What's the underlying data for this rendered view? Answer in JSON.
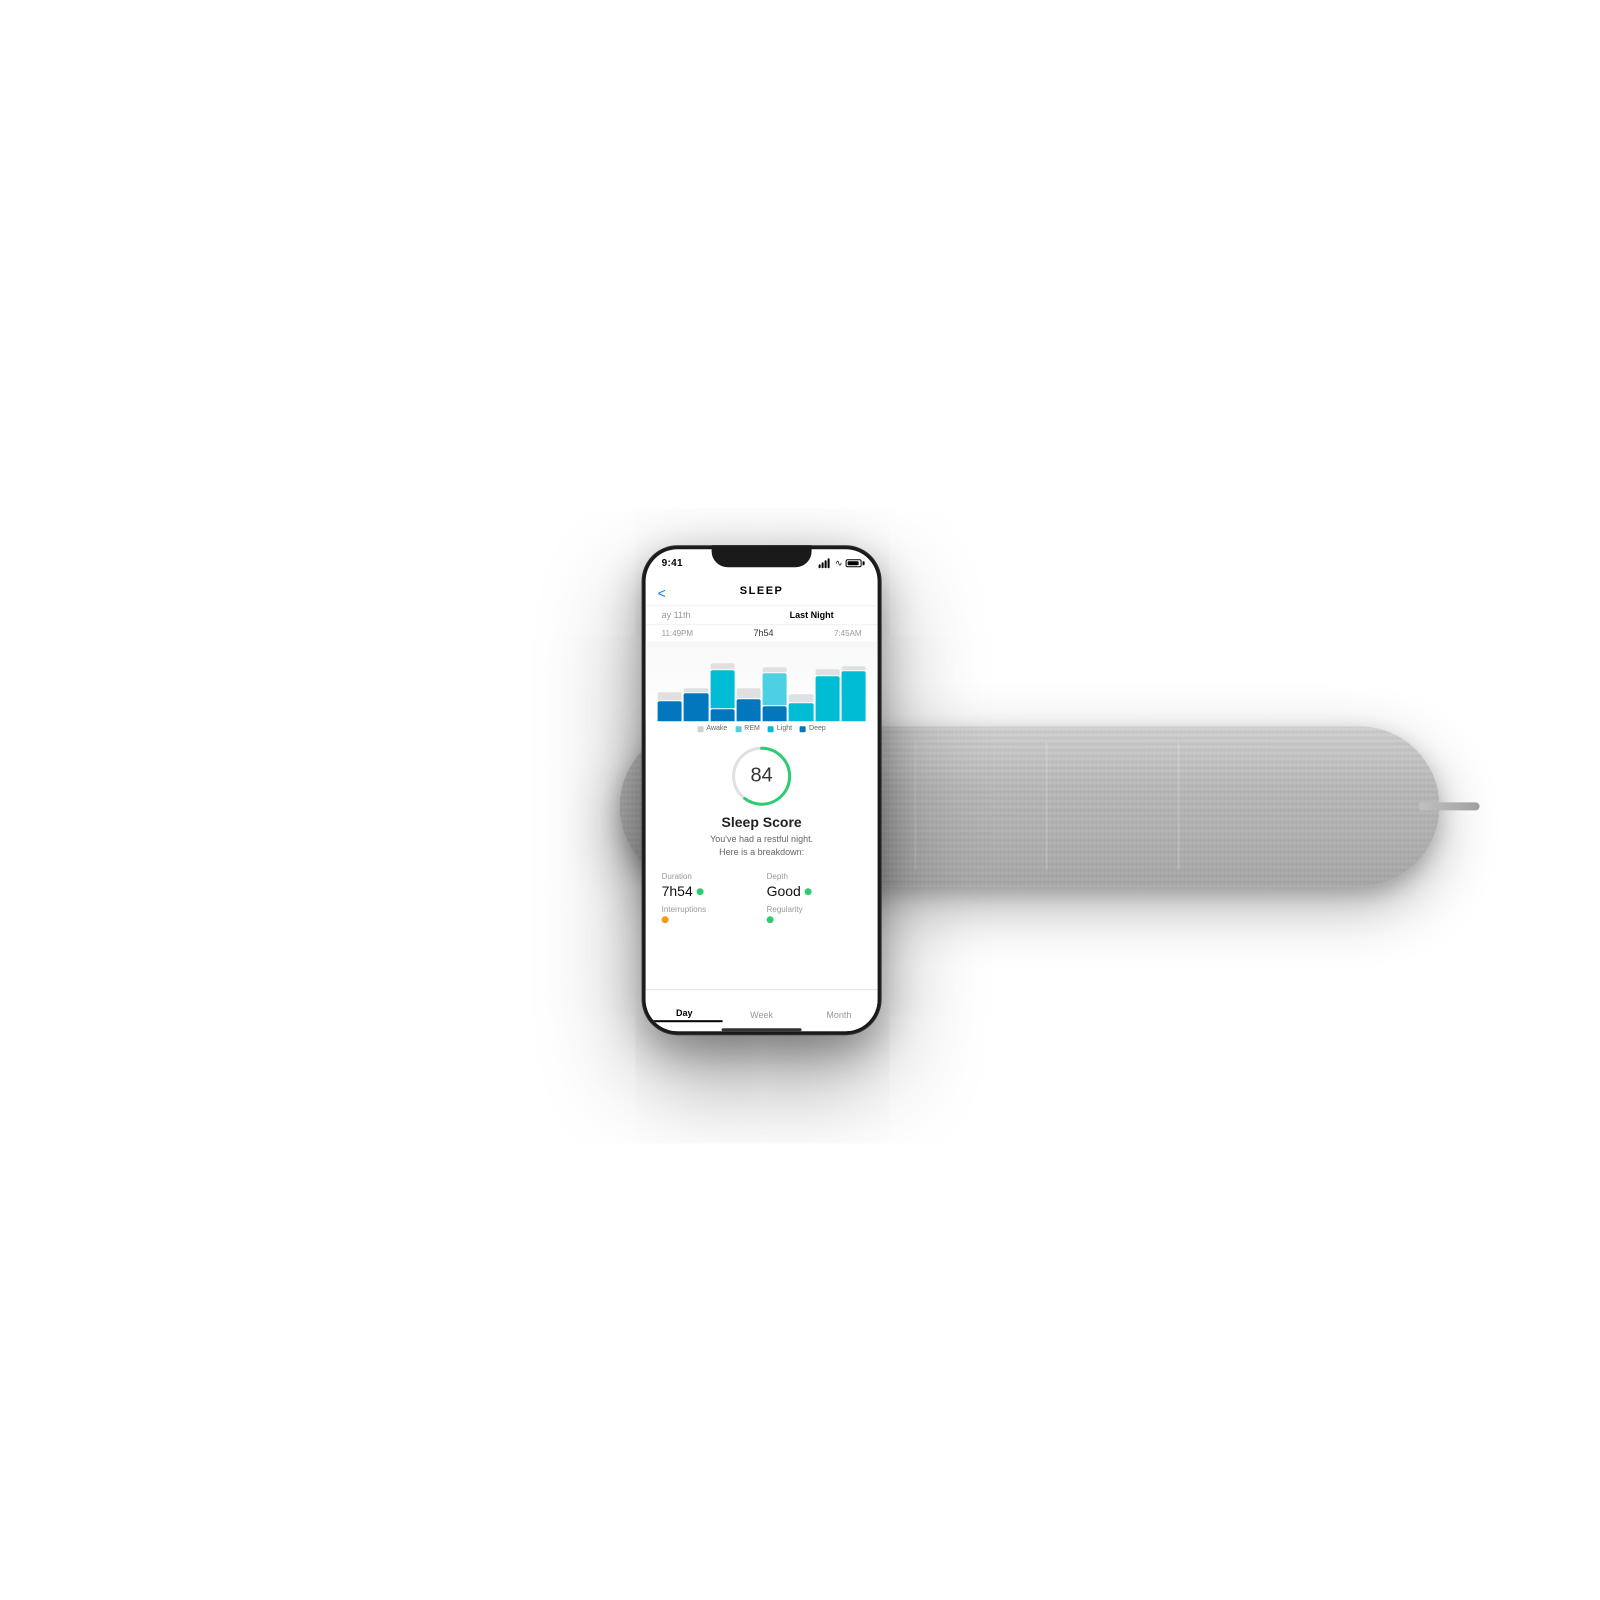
{
  "scene": {
    "background": "#ffffff"
  },
  "phone": {
    "status_bar": {
      "time": "9:41",
      "signal": "••••",
      "wifi": "WiFi",
      "battery": "Battery"
    },
    "header": {
      "back": "<",
      "title": "SLEEP"
    },
    "date_tabs": {
      "partial_date": "ay 11th",
      "active_tab": "Last Night"
    },
    "time_row": {
      "start": "11:49PM",
      "duration": "7h54",
      "end": "7:45AM"
    },
    "chart": {
      "legend": {
        "awake": "Awake",
        "rem": "REM",
        "light": "Light",
        "deep": "Deep"
      },
      "colors": {
        "awake": "#e0e0e0",
        "rem": "#4dd0e1",
        "light": "#00bcd4",
        "deep": "#0277bd"
      }
    },
    "sleep_score": {
      "value": "84",
      "title": "Sleep Score",
      "subtitle_line1": "You've had a restful night.",
      "subtitle_line2": "Here is a breakdown:"
    },
    "stats": {
      "duration_label": "Duration",
      "duration_value": "7h54",
      "depth_label": "Depth",
      "depth_value": "Good",
      "interruptions_label": "Interruptions",
      "regularity_label": "Regularity"
    },
    "tab_bar": {
      "day": "Day",
      "week": "Week",
      "month": "Month"
    }
  }
}
